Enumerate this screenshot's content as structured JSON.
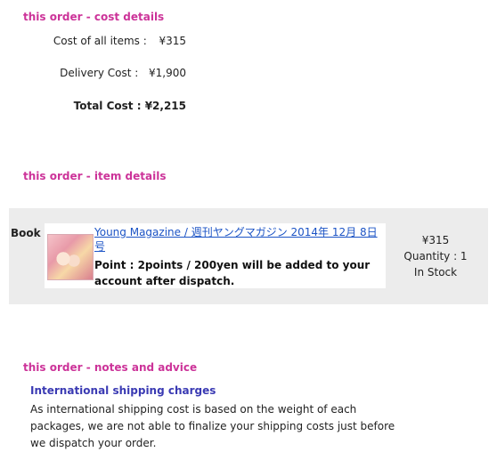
{
  "cost_section": {
    "title": "this order - cost details",
    "items_label": "Cost of all items :",
    "items_value": "¥315",
    "delivery_label": "Delivery Cost :",
    "delivery_value": "¥1,900",
    "total_label": "Total Cost :",
    "total_value": "¥2,215"
  },
  "item_section": {
    "title": "this order - item details",
    "item": {
      "type": "Book",
      "thumbnail_icon": "magazine-cover-image",
      "title": "Young Magazine / 週刊ヤングマガジン 2014年 12月 8日号",
      "points_text": "Point : 2points / 200yen will be added to your account after dispatch.",
      "price": "¥315",
      "quantity": "Quantity : 1",
      "stock": "In Stock"
    }
  },
  "notes_section": {
    "title": "this order - notes and advice",
    "heading": "International shipping charges",
    "body": "As international shipping cost is based on the weight of each packages, we are not able to finalize your shipping costs just before we dispatch your order."
  },
  "colors": {
    "section_title": "#cc3399",
    "link": "#1b53c5",
    "notes_heading": "#3a3ab3",
    "item_background": "#ececec"
  }
}
